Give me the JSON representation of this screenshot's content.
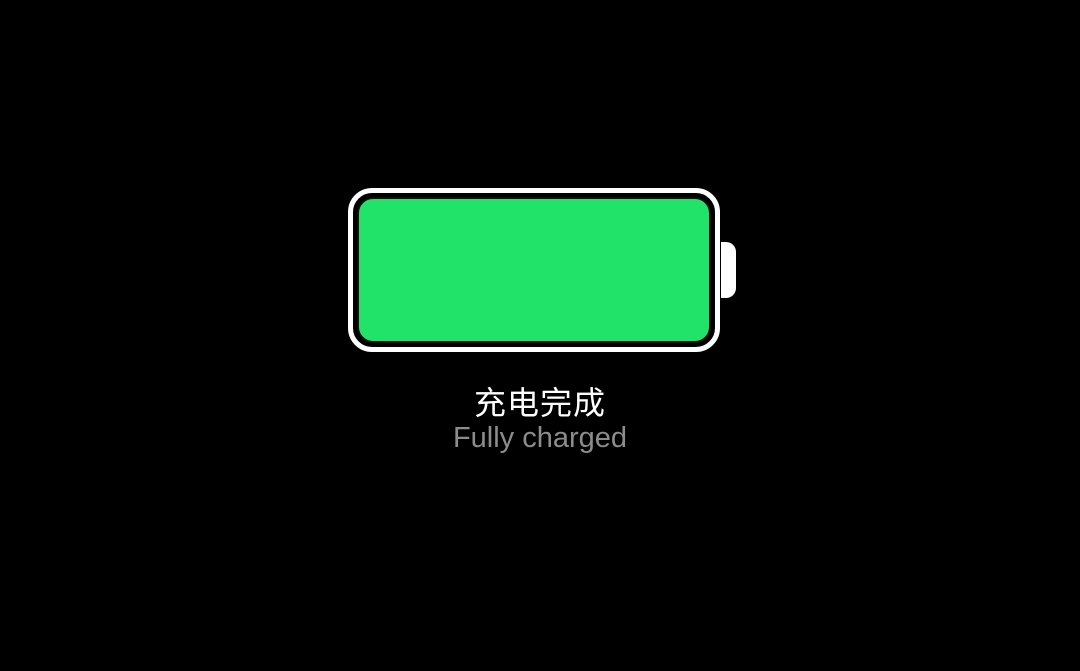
{
  "battery": {
    "charge_fraction": 1.0,
    "fill_color": "#22e36a",
    "outline_color": "#ffffff",
    "icon": "battery-full-icon"
  },
  "status": {
    "title": "充电完成",
    "subtitle": "Fully charged"
  },
  "colors": {
    "background": "#000000",
    "title_text": "#ffffff",
    "subtitle_text": "#8c8c8c"
  }
}
